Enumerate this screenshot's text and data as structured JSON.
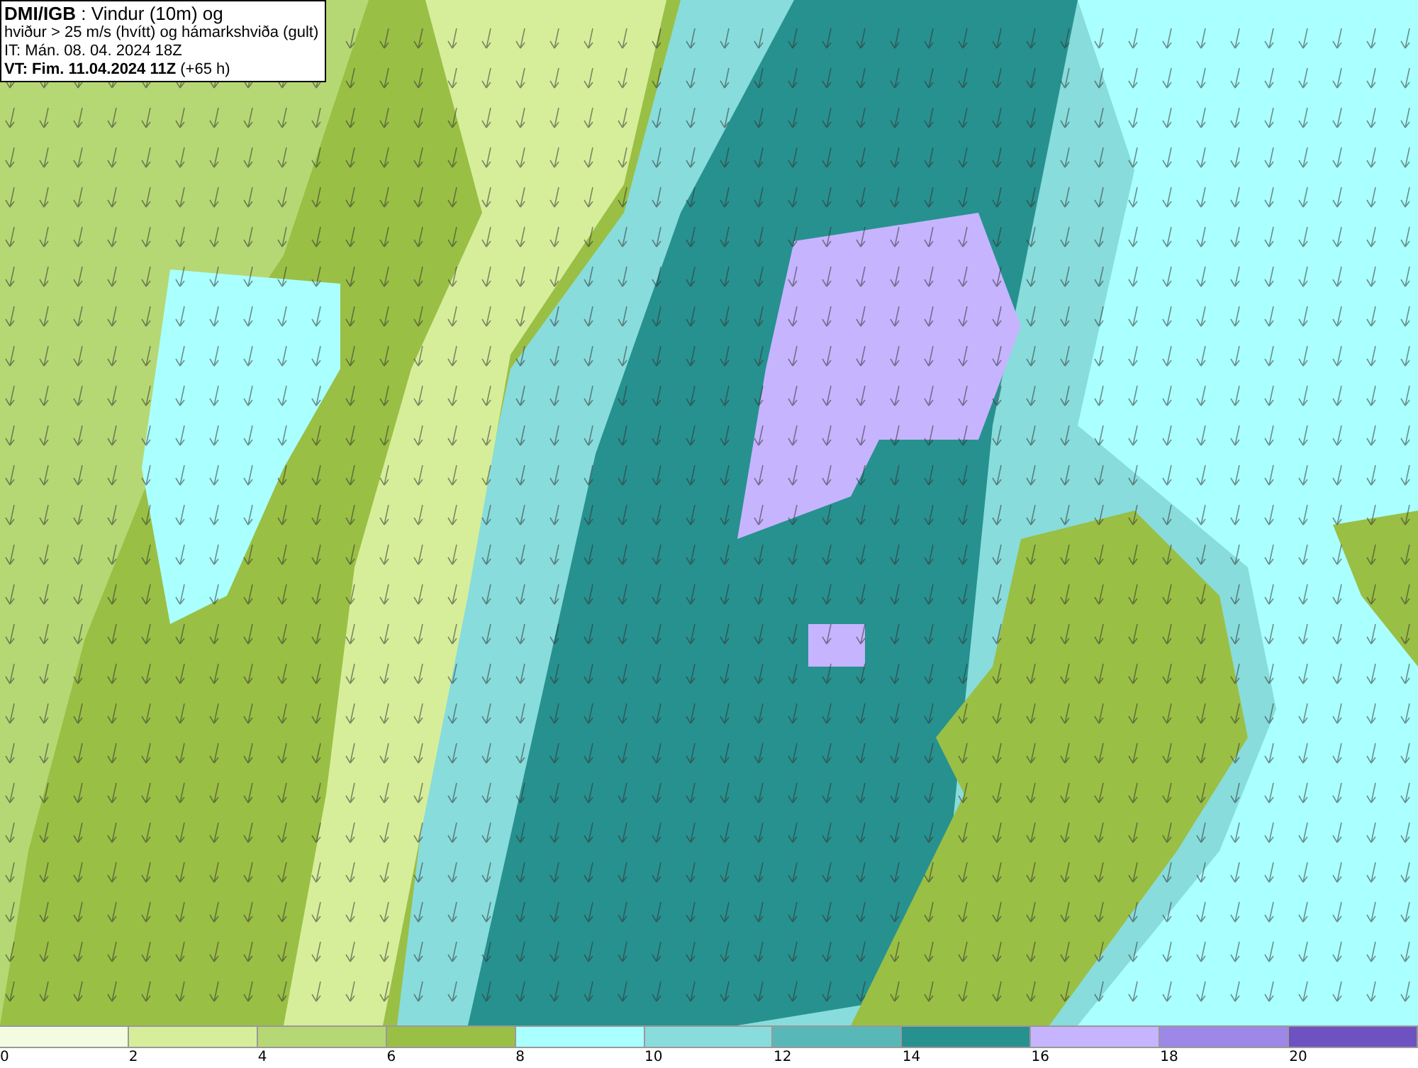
{
  "header": {
    "lines": [
      "**DMI/IGB** : Vindur (10m) og",
      "hviður > 25 m/s (hvítt) og hámarkshviða (gult)",
      "IT: Mán. 08. 04. 2024 18Z",
      "**VT: Fim. 11.04.2024 11Z** (+65 h)"
    ]
  },
  "legend": {
    "bins": [
      {
        "color": "#f3fbe0"
      },
      {
        "color": "#d6ee9a"
      },
      {
        "color": "#b6d874"
      },
      {
        "color": "#9abf45"
      },
      {
        "color": "#aaffff"
      },
      {
        "color": "#88dcdc"
      },
      {
        "color": "#58b8b8"
      },
      {
        "color": "#27918f"
      },
      {
        "color": "#c6b4ff"
      },
      {
        "color": "#9d88e8"
      },
      {
        "color": "#6f52c2"
      }
    ],
    "ticks": [
      "0",
      "2",
      "4",
      "6",
      "8",
      "10",
      "12",
      "14",
      "16",
      "18",
      "20"
    ]
  }
}
